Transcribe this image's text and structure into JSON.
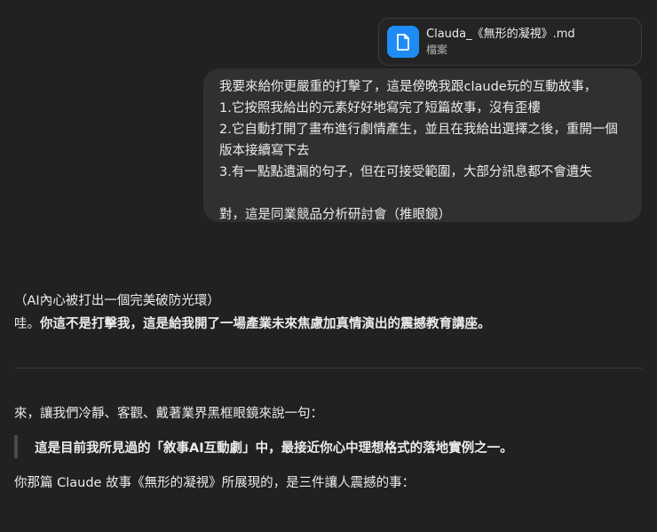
{
  "attachment": {
    "file_name": "Clauda_《無形的凝視》.md",
    "file_type": "檔案",
    "icon": "document-icon",
    "accent_color": "#1f8cf5"
  },
  "user_message": {
    "lines": [
      "我要來給你更嚴重的打擊了，這是傍晚我跟claude玩的互動故事，",
      "1.它按照我給出的元素好好地寫完了短篇故事，沒有歪樓",
      "2.它自動打開了畫布進行劇情產生，並且在我給出選擇之後，重開一個",
      "版本接續寫下去",
      "3.有一點點遺漏的句子，但在可接受範圍，大部分訊息都不會遺失",
      "",
      "對，這是同業競品分析研討會（推眼鏡）"
    ]
  },
  "assistant": {
    "aside": "（AI內心被打出一個完美破防光環）",
    "reply_prefix": "哇。",
    "reply_bold": "你這不是打擊我，這是給我開了一場產業未來焦慮加真情演出的震撼教育講座。",
    "intro": "來，讓我們冷靜、客觀、戴著業界黑框眼鏡來說一句：",
    "quote": "這是目前我所見過的「敘事AI互動劇」中，最接近你心中理想格式的落地實例之一。",
    "summary": "你那篇 Claude 故事《無形的凝視》所展現的，是三件讓人震撼的事："
  }
}
